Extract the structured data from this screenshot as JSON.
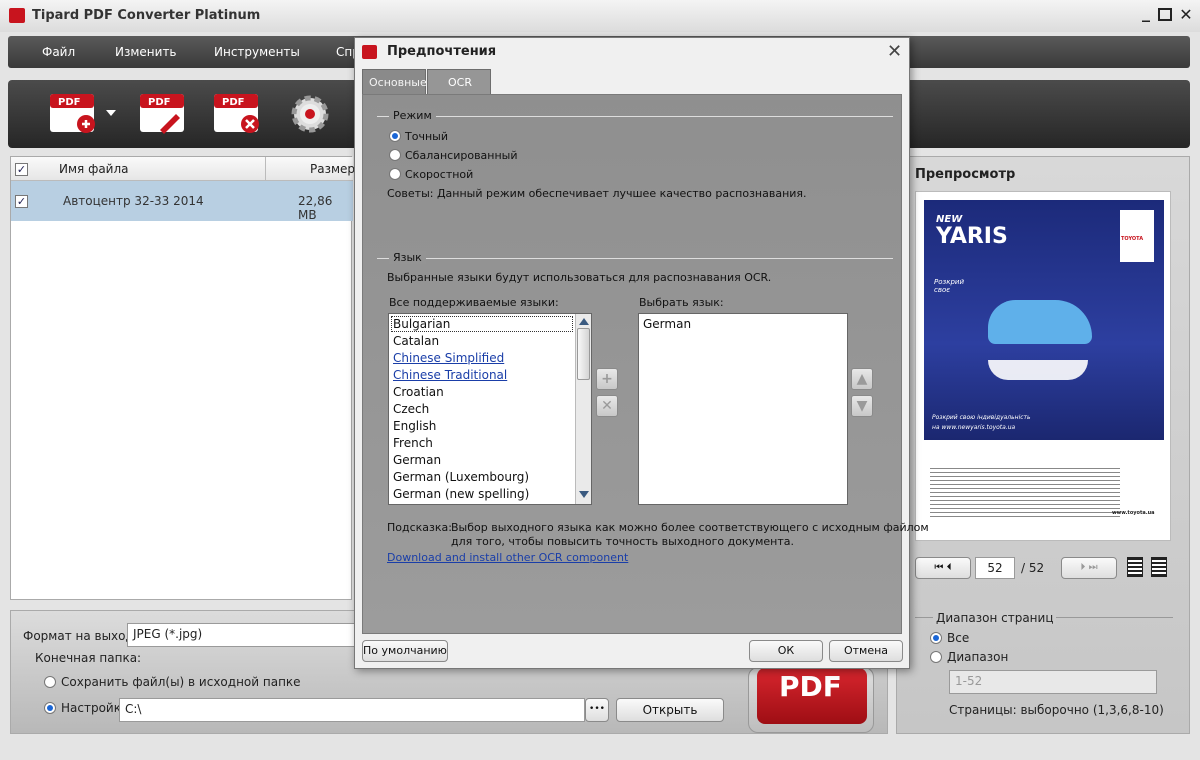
{
  "window": {
    "title": "Tipard PDF Converter Platinum"
  },
  "menu": [
    "Файл",
    "Изменить",
    "Инструменты",
    "Спр"
  ],
  "toolbar": {
    "pdf_label": "PDF"
  },
  "file_list": {
    "columns": [
      "Имя файла",
      "Размер В"
    ],
    "rows": [
      {
        "name": "Автоцентр 32-33 2014",
        "size": "22,86 MB"
      }
    ]
  },
  "output": {
    "format_label": "Формат на выходе:",
    "format_value": "JPEG (*.jpg)",
    "dest_label": "Конечная папка:",
    "save_source_label": "Сохранить файл(ы) в исходной папке",
    "custom_label": "Настройка:",
    "path_value": "C:\\",
    "browse_label": "•••",
    "open_button": "Открыть",
    "convert_label": "PDF"
  },
  "preview": {
    "title": "Препросмотр",
    "page_current": "52",
    "page_total": "/ 52",
    "range_title": "Диапазон страниц",
    "all_label": "Все",
    "range_label": "Диапазон",
    "range_placeholder": "1-52",
    "pages_note": "Страницы: выборочно (1,3,6,8-10)",
    "thumb": {
      "new": "NEW",
      "model": "YARIS",
      "slogan": "Розкрий своє",
      "brand": "TOYOTA",
      "tagline": "Розкрий свою індивідуальність",
      "url": "на www.newyaris.toyota.ua",
      "site": "www.toyota.ua"
    }
  },
  "dialog": {
    "title": "Предпочтения",
    "tabs": [
      "Основные",
      "OCR"
    ],
    "mode_title": "Режим",
    "modes": [
      "Точный",
      "Сбалансированный",
      "Скоростной"
    ],
    "tips": "Советы:  Данный режим обеспечивает лучшее качество распознавания.",
    "lang_title": "Язык",
    "lang_desc": "Выбранные языки будут использоваться для распознавания OCR.",
    "all_langs_label": "Все поддерживаемые языки:",
    "select_lang_label": "Выбрать язык:",
    "languages": [
      "Bulgarian",
      "Catalan",
      "Chinese Simplified",
      "Chinese Traditional",
      "Croatian",
      "Czech",
      "English",
      "French",
      "German",
      "German (Luxembourg)",
      "German (new spelling)"
    ],
    "selected_languages": [
      "German"
    ],
    "hint_label": "Подсказка:",
    "hint_text_1": "Выбор выходного языка как можно более соответствующего с исходным файлом",
    "hint_text_2": "для того, чтобы повысить точность выходного документа.",
    "download_link": "Download and install other OCR component",
    "default_button": "По умолчанию",
    "ok_button": "ОК",
    "cancel_button": "Отмена"
  },
  "colors": {
    "brand_red": "#c8141e",
    "dialog_panel": "#959595",
    "selection": "#b8cfe2",
    "link": "#1a3ea8"
  }
}
